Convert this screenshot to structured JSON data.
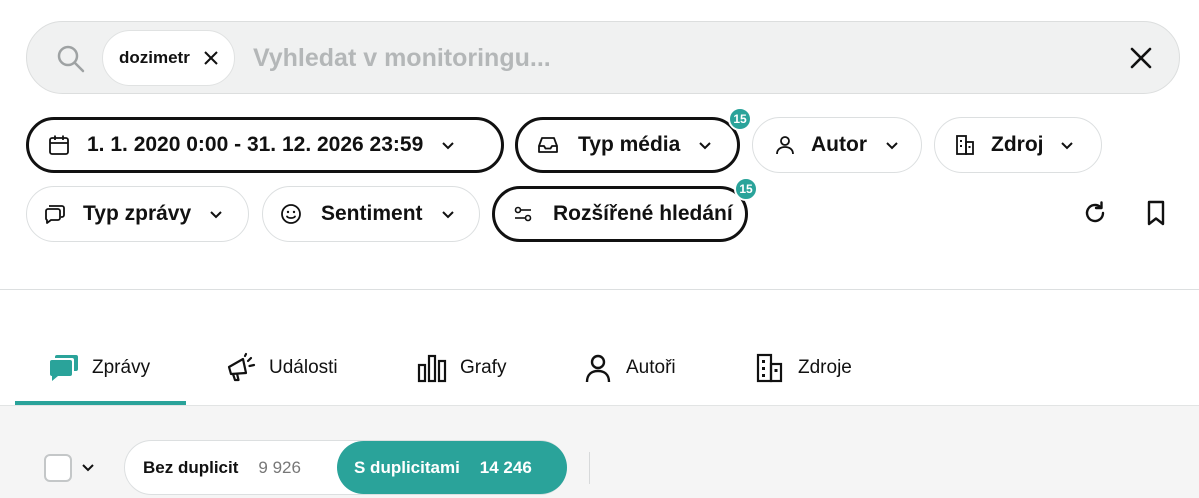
{
  "search": {
    "chip_label": "dozimetr",
    "placeholder": "Vyhledat v monitoringu...",
    "value": ""
  },
  "filters": {
    "date_range": "1. 1. 2020 0:00 - 31. 12. 2026 23:59",
    "media_type": "Typ média",
    "media_type_badge": "15",
    "author": "Autor",
    "source": "Zdroj",
    "message_type": "Typ zprávy",
    "sentiment": "Sentiment",
    "advanced_search": "Rozšířené hledání",
    "advanced_search_badge": "15"
  },
  "tabs": [
    {
      "label": "Zprávy",
      "icon": "chat-bubbles-icon",
      "active": true
    },
    {
      "label": "Události",
      "icon": "megaphone-icon"
    },
    {
      "label": "Grafy",
      "icon": "bar-chart-icon"
    },
    {
      "label": "Autoři",
      "icon": "person-icon"
    },
    {
      "label": "Zdroje",
      "icon": "building-icon"
    }
  ],
  "duplicates": {
    "without_label": "Bez duplicit",
    "without_count": "9 926",
    "with_label": "S duplicitami",
    "with_count": "14 246",
    "selected": "with"
  },
  "colors": {
    "accent": "#2aa39a",
    "text": "#111111",
    "placeholder": "#b4b7b8"
  }
}
